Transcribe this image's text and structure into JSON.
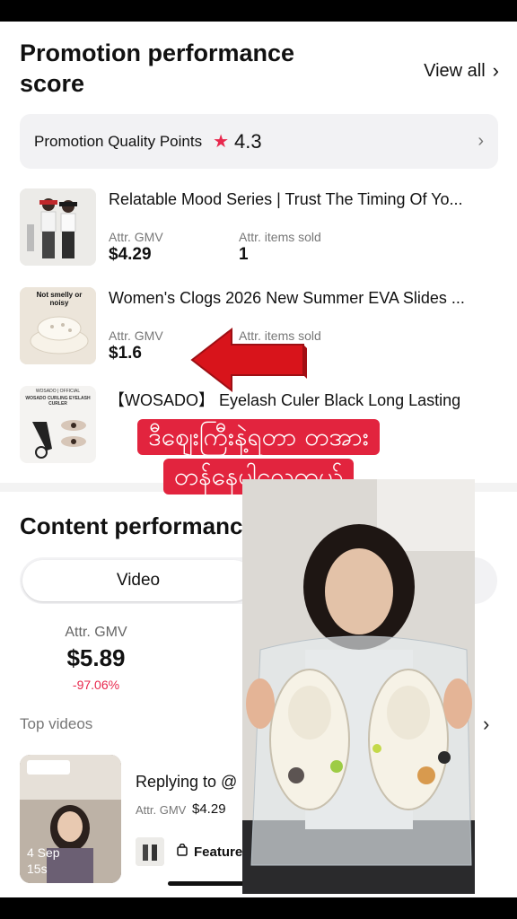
{
  "promotion": {
    "title": "Promotion performance score",
    "view_all": "View all",
    "quality_label": "Promotion Quality Points",
    "quality_value": "4.3"
  },
  "products": [
    {
      "name": "Relatable Mood Series | Trust The Timing Of Yo...",
      "gmv_label": "Attr. GMV",
      "gmv": "$4.29",
      "sold_label": "Attr. items sold",
      "sold": "1"
    },
    {
      "name": "Women's Clogs 2026 New Summer EVA Slides ...",
      "gmv_label": "Attr. GMV",
      "gmv": "$1.6",
      "sold_label": "Attr. items sold",
      "thumb_text": "Not smelly or noisy"
    },
    {
      "name": "【WOSADO】 Eyelash Culer Black Long Lasting",
      "thumb_brand": "WOSADO | OFFICIAL",
      "thumb_sub": "WOSADO CURLING EYELASH CURLER"
    }
  ],
  "overlay": {
    "line1": "ဒီဈေးကြီးနဲ့ရတာ တအား",
    "line2": "တန်နေပါလေကွယ်"
  },
  "content": {
    "title": "Content performance",
    "tab_video": "Video",
    "stats": [
      {
        "label": "Attr. GMV",
        "value": "$5.89",
        "change": "-97.06%"
      }
    ],
    "top_videos_label": "Top videos",
    "video": {
      "title": "Replying to @",
      "gmv_label": "Attr. GMV",
      "gmv": "$4.29",
      "date": "4 Sep",
      "duration": "15s",
      "featured": "Featured"
    }
  },
  "colors": {
    "accent": "#e8284d",
    "arrow": "#d8141b",
    "banner": "#e2243e"
  }
}
